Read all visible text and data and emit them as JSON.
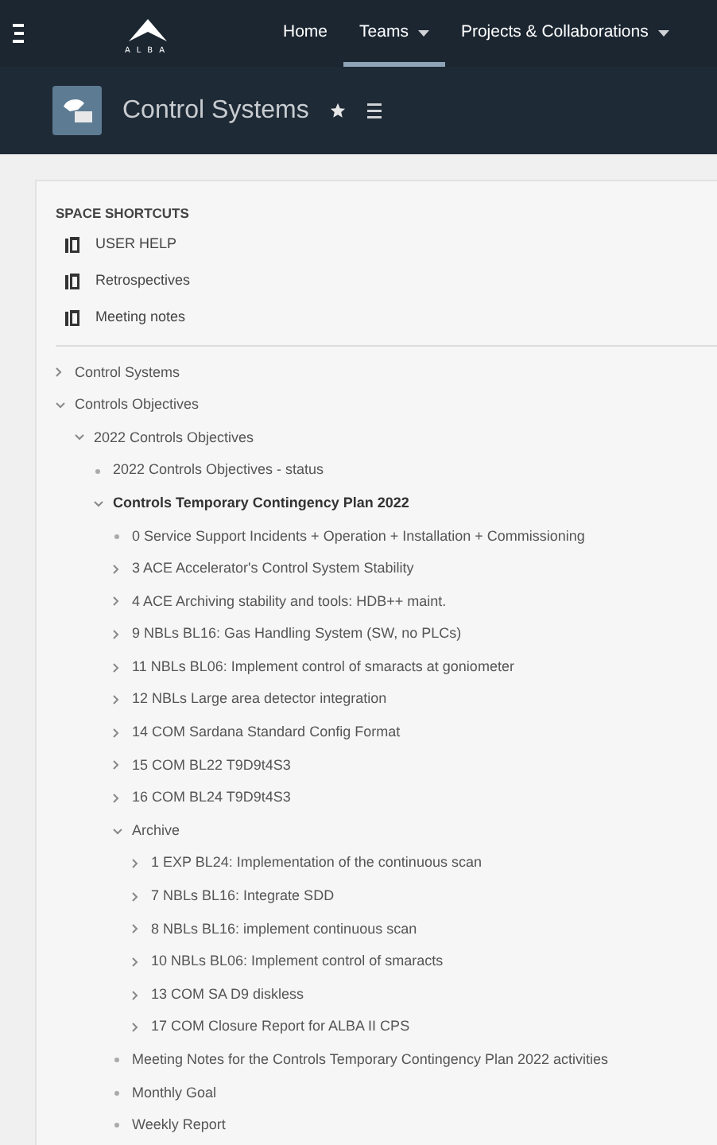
{
  "logo": {
    "text": "ALBA"
  },
  "nav": {
    "items": [
      {
        "label": "Home",
        "selected": false,
        "dropdown": false
      },
      {
        "label": "Teams",
        "selected": true,
        "dropdown": true
      },
      {
        "label": "Projects & Collaborations",
        "selected": false,
        "dropdown": true
      }
    ]
  },
  "space": {
    "title": "Control Systems"
  },
  "shortcuts": {
    "heading": "SPACE SHORTCUTS",
    "items": [
      "USER HELP",
      "Retrospectives",
      "Meeting notes"
    ]
  },
  "tree": [
    {
      "kind": "branch",
      "label": "Control Systems",
      "expanded": false,
      "selected": false
    },
    {
      "kind": "branch",
      "label": "Controls Objectives",
      "expanded": true,
      "selected": false,
      "children": [
        {
          "kind": "branch",
          "label": "2022 Controls Objectives",
          "expanded": true,
          "selected": false,
          "children": [
            {
              "kind": "leaf",
              "label": "2022 Controls Objectives - status",
              "selected": false
            },
            {
              "kind": "branch",
              "label": "Controls Temporary Contingency Plan 2022",
              "expanded": true,
              "selected": true,
              "children": [
                {
                  "kind": "leaf",
                  "label": "0 Service Support Incidents + Operation + Installation + Commissioning",
                  "selected": false
                },
                {
                  "kind": "branch",
                  "label": "3 ACE Accelerator's Control System Stability",
                  "expanded": false,
                  "selected": false
                },
                {
                  "kind": "branch",
                  "label": "4 ACE Archiving stability and tools: HDB++ maint.",
                  "expanded": false,
                  "selected": false
                },
                {
                  "kind": "branch",
                  "label": "9 NBLs BL16: Gas Handling System (SW, no PLCs)",
                  "expanded": false,
                  "selected": false
                },
                {
                  "kind": "branch",
                  "label": "11 NBLs BL06: Implement control of smaracts at goniometer",
                  "expanded": false,
                  "selected": false
                },
                {
                  "kind": "branch",
                  "label": "12 NBLs Large area detector integration",
                  "expanded": false,
                  "selected": false
                },
                {
                  "kind": "branch",
                  "label": "14 COM Sardana Standard Config Format",
                  "expanded": false,
                  "selected": false
                },
                {
                  "kind": "branch",
                  "label": "15 COM BL22 T9D9t4S3",
                  "expanded": false,
                  "selected": false
                },
                {
                  "kind": "branch",
                  "label": "16 COM BL24 T9D9t4S3",
                  "expanded": false,
                  "selected": false
                },
                {
                  "kind": "branch",
                  "label": "Archive",
                  "expanded": true,
                  "selected": false,
                  "children": [
                    {
                      "kind": "branch",
                      "label": "1 EXP BL24: Implementation of the continuous scan",
                      "expanded": false,
                      "selected": false
                    },
                    {
                      "kind": "branch",
                      "label": "7 NBLs BL16: Integrate SDD",
                      "expanded": false,
                      "selected": false
                    },
                    {
                      "kind": "branch",
                      "label": "8 NBLs BL16: implement continuous scan",
                      "expanded": false,
                      "selected": false
                    },
                    {
                      "kind": "branch",
                      "label": "10 NBLs BL06: Implement control of smaracts",
                      "expanded": false,
                      "selected": false
                    },
                    {
                      "kind": "branch",
                      "label": "13 COM SA D9 diskless",
                      "expanded": false,
                      "selected": false
                    },
                    {
                      "kind": "branch",
                      "label": "17 COM Closure Report for ALBA II CPS",
                      "expanded": false,
                      "selected": false
                    }
                  ]
                },
                {
                  "kind": "leaf",
                  "label": "Meeting Notes for the Controls Temporary Contingency Plan 2022 activities",
                  "selected": false
                },
                {
                  "kind": "leaf",
                  "label": "Monthly Goal",
                  "selected": false
                },
                {
                  "kind": "leaf",
                  "label": "Weekly Report",
                  "selected": false
                }
              ]
            }
          ]
        }
      ]
    }
  ]
}
